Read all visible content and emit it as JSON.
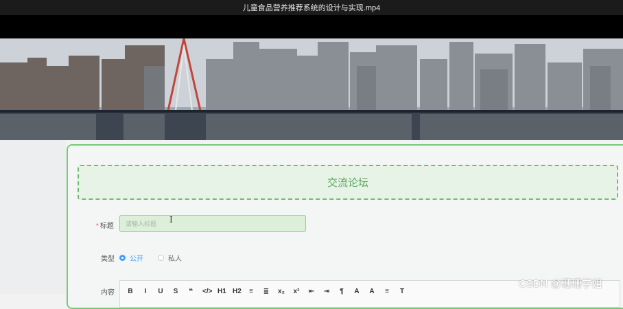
{
  "window": {
    "title": "儿童食品营养推荐系统的设计与实现.mp4"
  },
  "banner": {
    "slides": 3,
    "active_slide": 1
  },
  "forum": {
    "header_title": "交流论坛",
    "title_field": {
      "required_mark": "*",
      "label": "标题",
      "placeholder": "请输入标题",
      "value": ""
    },
    "type_field": {
      "label": "类型",
      "options": [
        {
          "label": "公开",
          "selected": true
        },
        {
          "label": "私人",
          "selected": false
        }
      ]
    },
    "content_field": {
      "label": "内容"
    },
    "toolbar_buttons": [
      "B",
      "I",
      "U",
      "S",
      "❝",
      "</>",
      "H1",
      "H2",
      "≡",
      "≣",
      "x₂",
      "x²",
      "⇤",
      "⇥",
      "¶",
      "A",
      "A",
      "≡",
      "T"
    ]
  },
  "watermark": "CSDN @珊珊学姐",
  "colors": {
    "accent_green": "#6cbf6c",
    "radio_blue": "#409eff"
  }
}
